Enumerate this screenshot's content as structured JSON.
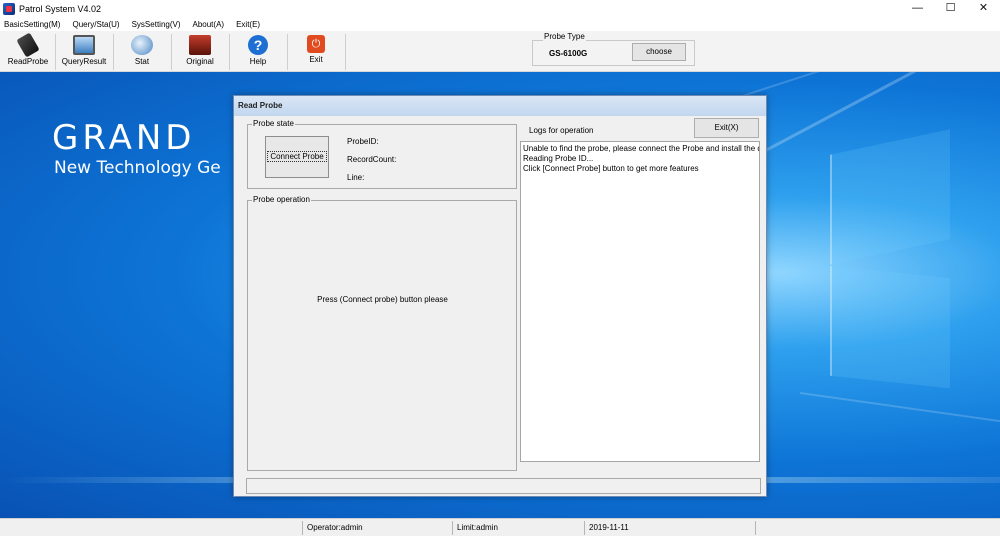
{
  "window": {
    "title": "Patrol System V4.02",
    "controls": {
      "minimize": "—",
      "maximize": "☐",
      "close": "✕"
    }
  },
  "menu": {
    "items": [
      "BasicSetting(M)",
      "Query/Sta(U)",
      "SysSetting(V)",
      "About(A)",
      "Exit(E)"
    ]
  },
  "toolbar": {
    "buttons": [
      {
        "label": "ReadProbe",
        "icon": "probe-reader-icon"
      },
      {
        "label": "QueryResult",
        "icon": "query-result-icon"
      },
      {
        "label": "Stat",
        "icon": "stat-icon"
      },
      {
        "label": "Original",
        "icon": "original-record-icon"
      },
      {
        "label": "Help",
        "icon": "help-icon",
        "glyph": "?"
      },
      {
        "label": "Exit",
        "icon": "power-icon",
        "glyph": "⏻"
      }
    ]
  },
  "probe_type": {
    "label": "Probe Type",
    "model": "GS-6100G",
    "choose_label": "choose"
  },
  "desktop": {
    "brand": "GRAND",
    "slogan": "New Technology Ge"
  },
  "dialog": {
    "title": "Read Probe",
    "probe_state_label": "Probe state",
    "connect_label": "Connect Probe",
    "info": {
      "probe_id": "ProbeID:",
      "record_count": "RecordCount:",
      "line": "Line:"
    },
    "probe_operation_label": "Probe operation",
    "operation_hint": "Press (Connect probe) button please",
    "logs_title": "Logs for operation",
    "exit_label": "Exit(X)",
    "logs": [
      "Unable to find the probe, please connect the Probe and install the dr",
      "Reading Probe ID...",
      "Click [Connect Probe] button to get more features"
    ]
  },
  "statusbar": {
    "operator": "Operator:admin",
    "limit": "Limit:admin",
    "date": "2019-11-11"
  },
  "colors": {
    "accent_blue": "#0d74d6",
    "dialog_title": "#c2d6ee",
    "exit_icon": "#e04a1e",
    "help_icon": "#1e6fd4"
  }
}
